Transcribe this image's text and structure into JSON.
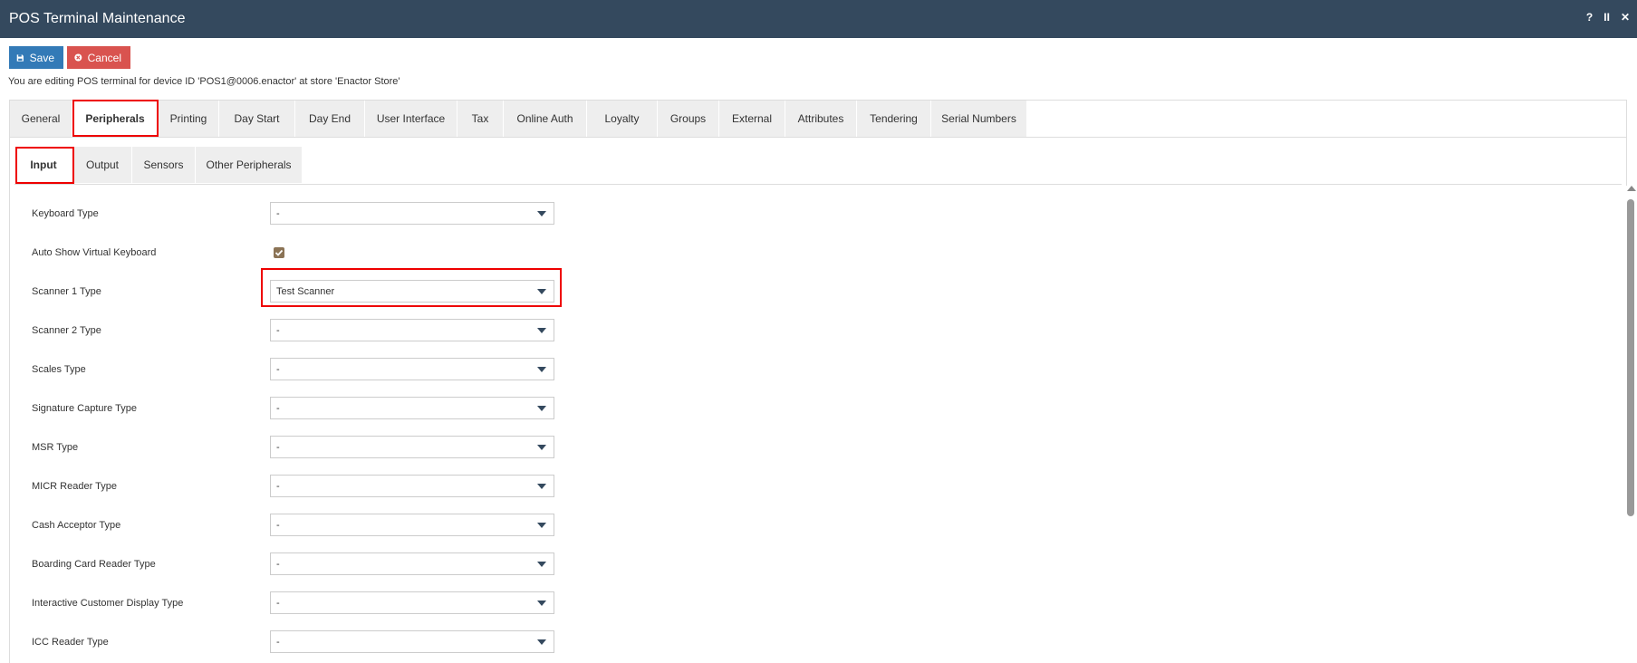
{
  "window": {
    "title": "POS Terminal Maintenance",
    "controls": {
      "help": "?",
      "pause": "II",
      "close": "✕"
    }
  },
  "toolbar": {
    "save_label": "Save",
    "cancel_label": "Cancel"
  },
  "info": "You are editing POS terminal for device ID 'POS1@0006.enactor' at store 'Enactor Store'",
  "main_tabs": [
    {
      "label": "General"
    },
    {
      "label": "Peripherals"
    },
    {
      "label": "Printing"
    },
    {
      "label": "Day Start"
    },
    {
      "label": "Day End"
    },
    {
      "label": "User Interface"
    },
    {
      "label": "Tax"
    },
    {
      "label": "Online Auth"
    },
    {
      "label": "Loyalty"
    },
    {
      "label": "Groups"
    },
    {
      "label": "External"
    },
    {
      "label": "Attributes"
    },
    {
      "label": "Tendering"
    },
    {
      "label": "Serial Numbers"
    }
  ],
  "active_main_tab": "Peripherals",
  "sub_tabs": [
    {
      "label": "Input"
    },
    {
      "label": "Output"
    },
    {
      "label": "Sensors"
    },
    {
      "label": "Other Peripherals"
    }
  ],
  "active_sub_tab": "Input",
  "fields": [
    {
      "label": "Keyboard Type",
      "type": "select",
      "value": "-"
    },
    {
      "label": "Auto Show Virtual Keyboard",
      "type": "checkbox",
      "checked": true
    },
    {
      "label": "Scanner 1 Type",
      "type": "select",
      "value": "Test Scanner"
    },
    {
      "label": "Scanner 2 Type",
      "type": "select",
      "value": "-"
    },
    {
      "label": "Scales Type",
      "type": "select",
      "value": "-"
    },
    {
      "label": "Signature Capture Type",
      "type": "select",
      "value": "-"
    },
    {
      "label": "MSR Type",
      "type": "select",
      "value": "-"
    },
    {
      "label": "MICR Reader Type",
      "type": "select",
      "value": "-"
    },
    {
      "label": "Cash Acceptor Type",
      "type": "select",
      "value": "-"
    },
    {
      "label": "Boarding Card Reader Type",
      "type": "select",
      "value": "-"
    },
    {
      "label": "Interactive Customer Display Type",
      "type": "select",
      "value": "-"
    },
    {
      "label": "ICC Reader Type",
      "type": "select",
      "value": "-"
    }
  ],
  "colors": {
    "titlebar": "#34495e",
    "save": "#337ab7",
    "cancel": "#d9534f",
    "highlight": "#e00000",
    "checkbox": "#8b7355"
  }
}
